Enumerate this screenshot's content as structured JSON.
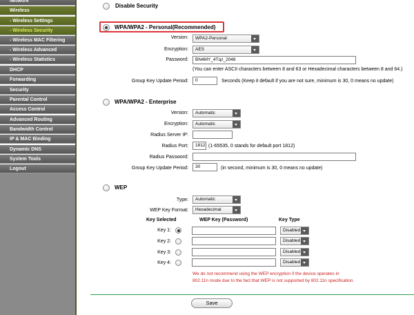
{
  "sidebar": {
    "items": [
      {
        "label": "Network"
      },
      {
        "label": "Wireless"
      },
      {
        "label": "- Wireless Settings"
      },
      {
        "label": "- Wireless Security"
      },
      {
        "label": "- Wireless MAC Filtering"
      },
      {
        "label": "- Wireless Advanced"
      },
      {
        "label": "- Wireless Statistics"
      },
      {
        "label": "DHCP"
      },
      {
        "label": "Forwarding"
      },
      {
        "label": "Security"
      },
      {
        "label": "Parental Control"
      },
      {
        "label": "Access Control"
      },
      {
        "label": "Advanced Routing"
      },
      {
        "label": "Bandwidth Control"
      },
      {
        "label": "IP & MAC Binding"
      },
      {
        "label": "Dynamic DNS"
      },
      {
        "label": "System Tools"
      },
      {
        "label": "Logout"
      }
    ]
  },
  "disable": {
    "label": "Disable Security"
  },
  "wpa_personal": {
    "title": "WPA/WPA2 - Personal(Recommended)",
    "version_label": "Version:",
    "version_value": "WPA2-Personal",
    "encryption_label": "Encryption:",
    "encryption_value": "AES",
    "password_label": "Password:",
    "password_value": "BN4MY_4Tqz_2048",
    "password_hint": "(You can enter ASCII characters between 8 and 63 or Hexadecimal characters between 8 and 64.)",
    "gkup_label": "Group Key Update Period:",
    "gkup_value": "0",
    "gkup_hint": "Seconds (Keep it default if you are not sure, minimum is 30, 0 means no update)"
  },
  "wpa_enterprise": {
    "title": "WPA/WPA2 - Enterprise",
    "version_label": "Version:",
    "version_value": "Automatic",
    "encryption_label": "Encryption:",
    "encryption_value": "Automatic",
    "server_ip_label": "Radius Server IP:",
    "server_ip_value": "",
    "port_label": "Radius Port:",
    "port_value": "1812",
    "port_hint": "(1-65535, 0 stands for default port 1812)",
    "radius_pw_label": "Radius Password:",
    "radius_pw_value": "",
    "gkup_label": "Group Key Update Period:",
    "gkup_value": "30",
    "gkup_hint": "(in second, minimum is 30, 0 means no update)"
  },
  "wep": {
    "title": "WEP",
    "type_label": "Type:",
    "type_value": "Automatic",
    "format_label": "WEP Key Format:",
    "format_value": "Hexadecimal",
    "col_selected": "Key Selected",
    "col_key": "WEP Key (Password)",
    "col_type": "Key Type",
    "keys": [
      {
        "label": "Key 1:",
        "value": "",
        "type": "Disabled"
      },
      {
        "label": "Key 2:",
        "value": "",
        "type": "Disabled"
      },
      {
        "label": "Key 3:",
        "value": "",
        "type": "Disabled"
      },
      {
        "label": "Key 4:",
        "value": "",
        "type": "Disabled"
      }
    ],
    "warning_line1": "We do not recommend using the WEP encryption if the device operates in",
    "warning_line2": "802.11n mode due to the fact that WEP is not supported by 802.11n specification."
  },
  "save_label": "Save",
  "colors": {
    "accent": "#56661f",
    "warning": "#cc1b1b",
    "highlight": "#d9343a",
    "divider": "#2f9a4f"
  }
}
